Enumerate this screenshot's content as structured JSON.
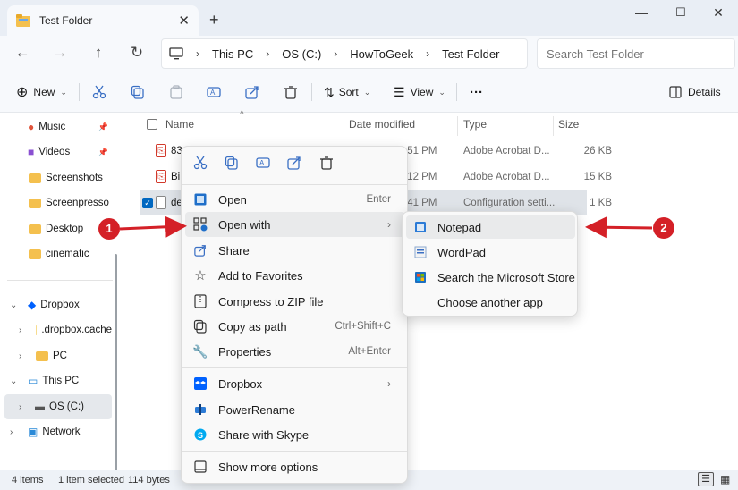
{
  "window": {
    "tab_title": "Test Folder",
    "new_tab": "+",
    "minimize": "—",
    "maximize": "☐",
    "close": "✕"
  },
  "address_bar": {
    "crumbs": [
      "This PC",
      "OS (C:)",
      "HowToGeek",
      "Test Folder"
    ],
    "search_placeholder": "Search Test Folder"
  },
  "command_bar": {
    "new_label": "New",
    "sort_label": "Sort",
    "view_label": "View",
    "more_label": "···",
    "details_label": "Details"
  },
  "sidebar": {
    "items": [
      {
        "label": "Music",
        "pinned": true
      },
      {
        "label": "Videos",
        "pinned": true
      },
      {
        "label": "Screenshots"
      },
      {
        "label": "Screenpresso"
      },
      {
        "label": "Desktop"
      },
      {
        "label": "cinematic"
      },
      {
        "label": "Dropbox"
      },
      {
        "label": ".dropbox.cache"
      },
      {
        "label": "PC"
      },
      {
        "label": "This PC"
      },
      {
        "label": "OS (C:)"
      },
      {
        "label": "Network"
      }
    ]
  },
  "file_list": {
    "headers": {
      "name": "Name",
      "date": "Date modified",
      "type": "Type",
      "size": "Size"
    },
    "rows": [
      {
        "name": "83",
        "date": ":51 PM",
        "type": "Adobe Acrobat D...",
        "size": "26 KB"
      },
      {
        "name": "Bil",
        "date": ":12 PM",
        "type": "Adobe Acrobat D...",
        "size": "15 KB"
      },
      {
        "name": "de",
        "date": ":41 PM",
        "type": "Configuration setti...",
        "size": "1 KB"
      }
    ]
  },
  "context_menu": {
    "items": [
      {
        "label": "Open",
        "shortcut": "Enter"
      },
      {
        "label": "Open with",
        "arrow": "›"
      },
      {
        "label": "Share"
      },
      {
        "label": "Add to Favorites"
      },
      {
        "label": "Compress to ZIP file"
      },
      {
        "label": "Copy as path",
        "shortcut": "Ctrl+Shift+C"
      },
      {
        "label": "Properties",
        "shortcut": "Alt+Enter"
      },
      {
        "label": "Dropbox",
        "arrow": "›"
      },
      {
        "label": "PowerRename"
      },
      {
        "label": "Share with Skype"
      },
      {
        "label": "Show more options"
      }
    ]
  },
  "open_with_submenu": {
    "items": [
      {
        "label": "Notepad"
      },
      {
        "label": "WordPad"
      },
      {
        "label": "Search the Microsoft Store"
      },
      {
        "label": "Choose another app"
      }
    ]
  },
  "annotations": {
    "one": "1",
    "two": "2",
    "color": "#d42027"
  },
  "status_bar": {
    "item_count": "4 items",
    "selection": "1 item selected",
    "size": "114 bytes"
  }
}
